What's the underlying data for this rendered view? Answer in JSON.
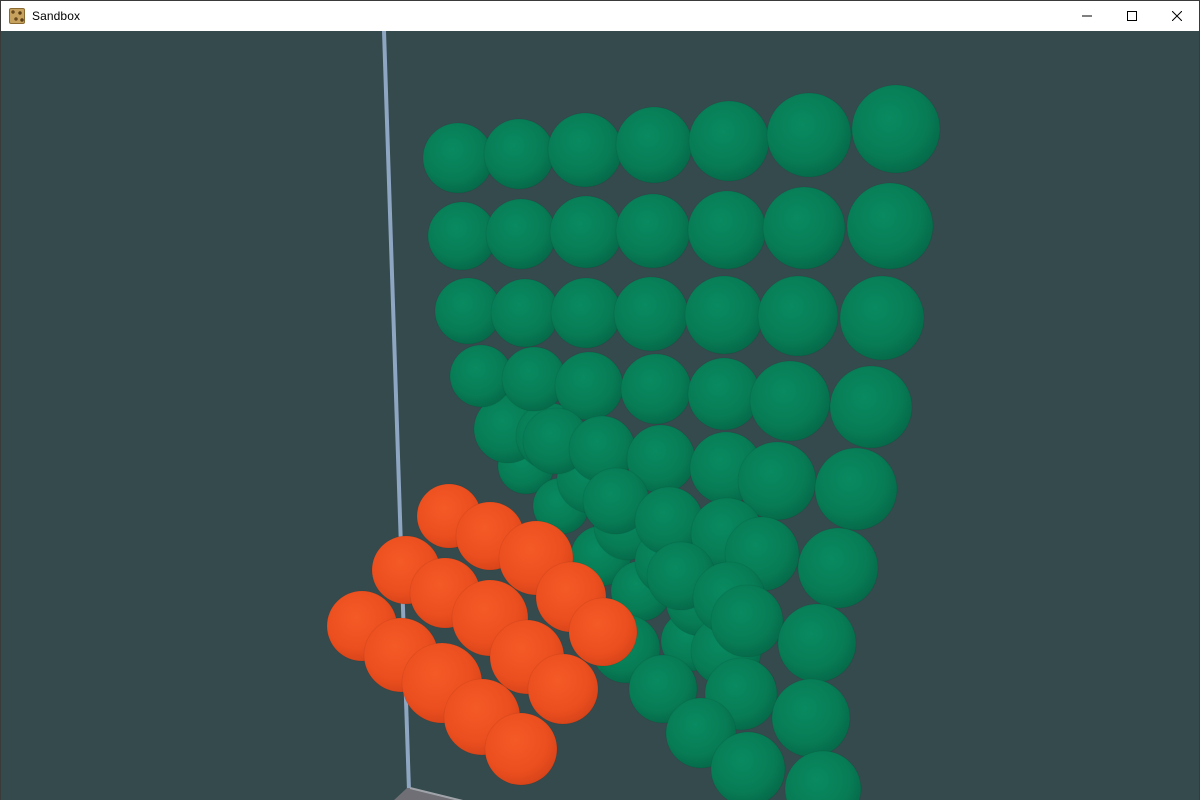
{
  "window": {
    "title": "Sandbox",
    "controls": {
      "minimize": "minimize-icon",
      "maximize": "maximize-icon",
      "close": "close-icon"
    }
  },
  "scene": {
    "background_color": "#344a4c",
    "container_edge_color": "#8ea6c2",
    "floor_color": "#6f6f75",
    "green_sphere_color": "#077c55",
    "orange_sphere_color": "#ef5020"
  }
}
